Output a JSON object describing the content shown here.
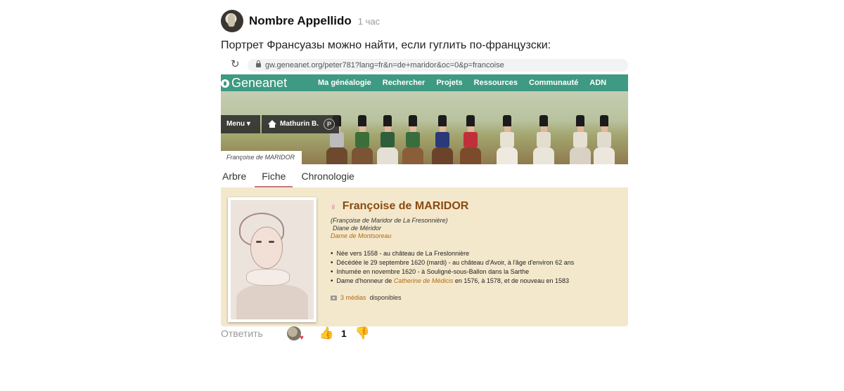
{
  "post": {
    "author": "Nombre Appellido",
    "time": "1 час",
    "text": "Портрет Франсуазы можно найти, если гуглить по-французски:"
  },
  "screenshot": {
    "url": "gw.geneanet.org/peter781?lang=fr&n=de+maridor&oc=0&p=francoise",
    "logo": "Geneanet",
    "nav": [
      "Ma généalogie",
      "Rechercher",
      "Projets",
      "Ressources",
      "Communauté",
      "ADN"
    ],
    "menu_label": "Menu ▾",
    "person_label": "Mathurin B.",
    "person_badge": "P",
    "name_tab": "Françoise de MARIDOR",
    "tabs": [
      "Arbre",
      "Fiche",
      "Chronologie"
    ],
    "active_tab": "Fiche",
    "full_name": "Françoise de MARIDOR",
    "gender_symbol": "♀",
    "alias_1": "(Françoise de Maridor de La Fresonnière)",
    "alias_2": "Diane de Méridor",
    "alias_3": "Dame de Montsoreau",
    "fact_1": "Née vers 1558 - au château de La Freslonnière",
    "fact_2": "Décédée le 29 septembre 1620 (mardi) - au château d'Avoir, à l'âge d'environ 62 ans",
    "fact_3": "Inhumée en novembre 1620 - à Souligné-sous-Ballon dans la Sarthe",
    "fact_4_pre": "Dame d'honneur de",
    "fact_4_link": "Catherine de Médicis",
    "fact_4_post": "en 1576, à 1578, et de nouveau en 1583",
    "media_link": "3 médias",
    "media_text": "disponibles"
  },
  "actions": {
    "reply": "Ответить",
    "like_count": "1"
  },
  "colors": {
    "geneanet_green": "#3e9a82",
    "card_bg": "#f4e8cc",
    "name_color": "#8a4b12",
    "active_tab_underline": "#c7797e"
  },
  "icons": [
    "reload-icon",
    "lock-icon",
    "geneanet-leaf-icon",
    "home-icon",
    "female-icon",
    "camera-icon",
    "thumbs-up-icon",
    "thumbs-down-icon",
    "heart-icon"
  ]
}
